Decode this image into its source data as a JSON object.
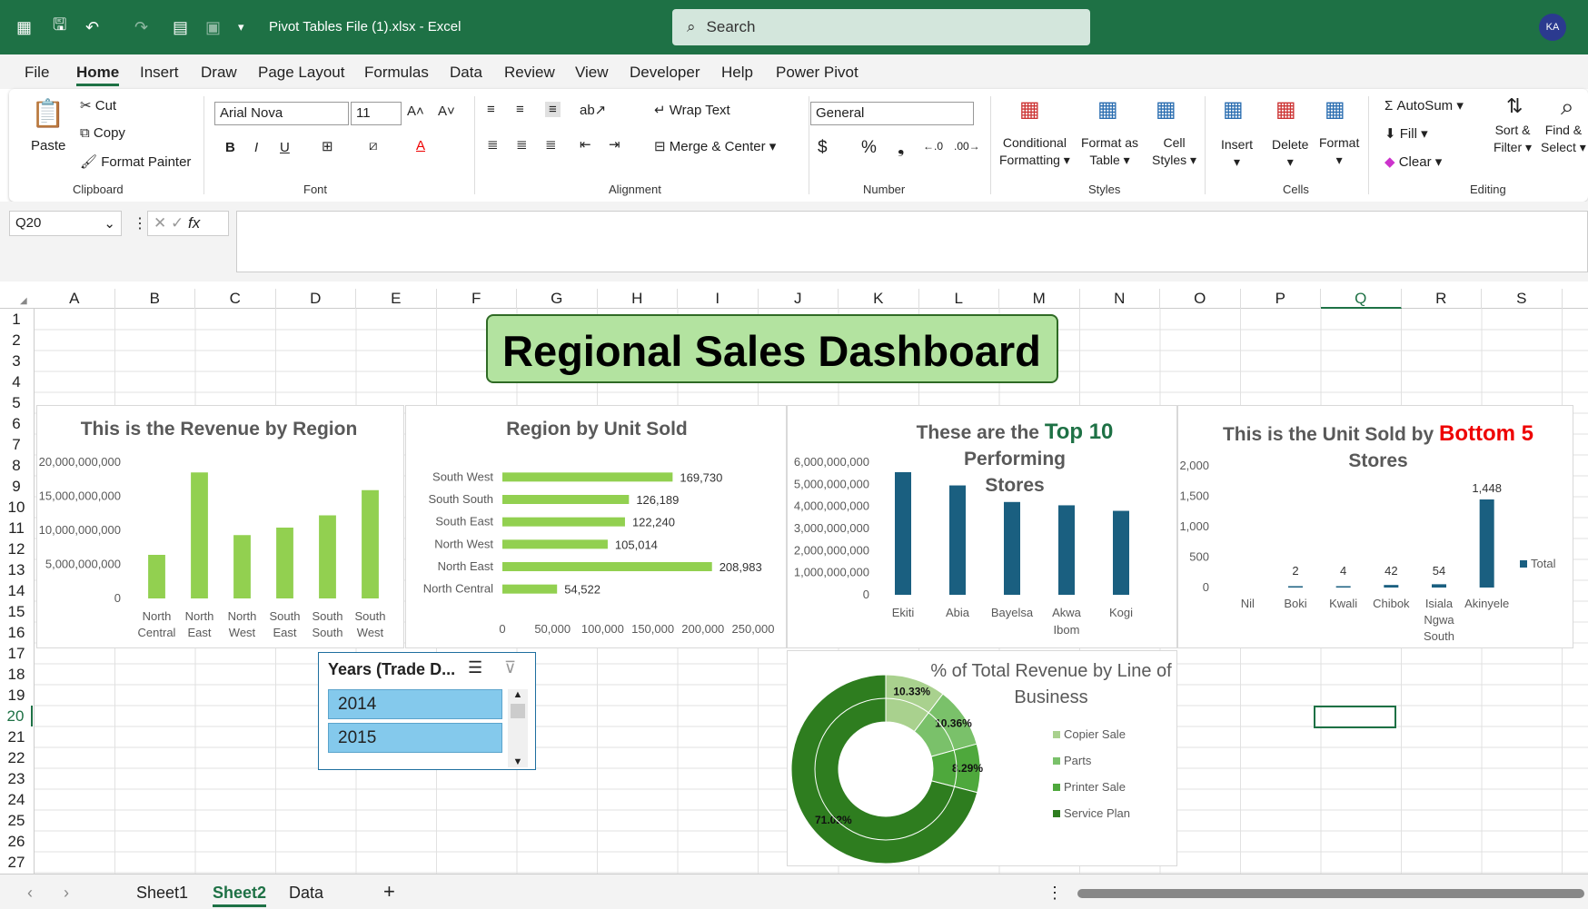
{
  "title": {
    "file": "Pivot Tables File (1).xlsx  -  Excel",
    "search_placeholder": "Search",
    "avatar": "KA"
  },
  "menu": [
    "File",
    "Home",
    "Insert",
    "Draw",
    "Page Layout",
    "Formulas",
    "Data",
    "Review",
    "View",
    "Developer",
    "Help",
    "Power Pivot"
  ],
  "ribbon": {
    "paste": "Paste",
    "cut": "Cut",
    "copy": "Copy",
    "format_painter": "Format Painter",
    "clipboard": "Clipboard",
    "font_name": "Arial Nova",
    "font_size": "11",
    "font": "Font",
    "wrap": "Wrap Text",
    "merge": "Merge & Center",
    "alignment": "Alignment",
    "numfmt": "General",
    "number": "Number",
    "cond1": "Conditional",
    "cond2": "Formatting",
    "fat1": "Format as",
    "fat2": "Table",
    "cs1": "Cell",
    "cs2": "Styles",
    "styles": "Styles",
    "insert": "Insert",
    "delete": "Delete",
    "format": "Format",
    "cells": "Cells",
    "autosum": "AutoSum",
    "fill": "Fill",
    "clear": "Clear",
    "sort1": "Sort &",
    "sort2": "Filter",
    "find1": "Find &",
    "find2": "Select",
    "editing": "Editing"
  },
  "namebox": "Q20",
  "columns": [
    "A",
    "B",
    "C",
    "D",
    "E",
    "F",
    "G",
    "H",
    "I",
    "J",
    "K",
    "L",
    "M",
    "N",
    "O",
    "P",
    "Q",
    "R",
    "S"
  ],
  "rows": [
    "1",
    "2",
    "3",
    "4",
    "5",
    "6",
    "7",
    "8",
    "9",
    "10",
    "11",
    "12",
    "13",
    "14",
    "15",
    "16",
    "17",
    "18",
    "19",
    "20",
    "21",
    "22",
    "23",
    "24",
    "25",
    "26",
    "27"
  ],
  "banner": "Regional Sales Dashboard",
  "chart_data": [
    {
      "type": "bar",
      "title": "This is the Revenue by Region",
      "categories": [
        "North Central",
        "North East",
        "North West",
        "South East",
        "South South",
        "South West"
      ],
      "values": [
        6400000000,
        18500000000,
        9300000000,
        10400000000,
        12200000000,
        15900000000
      ],
      "ylim": [
        0,
        20000000000
      ],
      "yticks": [
        "20,000,000,000",
        "15,000,000,000",
        "10,000,000,000",
        "5,000,000,000",
        "0"
      ],
      "color": "#92d050"
    },
    {
      "type": "bar",
      "orientation": "horizontal",
      "title": "Region by Unit Sold",
      "categories": [
        "South West",
        "South South",
        "South East",
        "North West",
        "North East",
        "North Central"
      ],
      "values": [
        169730,
        126189,
        122240,
        105014,
        208983,
        54522
      ],
      "labels": [
        "169,730",
        "126,189",
        "122,240",
        "105,014",
        "208,983",
        "54,522"
      ],
      "xlim": [
        0,
        250000
      ],
      "xticks": [
        "0",
        "50,000",
        "100,000",
        "150,000",
        "200,000",
        "250,000"
      ],
      "color": "#92d050"
    },
    {
      "type": "bar",
      "title_a": "These are the ",
      "title_b": "Top 10",
      "title_c": " Performing",
      "title_d": "Stores",
      "categories": [
        "Ekiti",
        "Abia",
        "Bayelsa",
        "Akwa Ibom",
        "Kogi"
      ],
      "values": [
        5550000000,
        4950000000,
        4200000000,
        4050000000,
        3800000000
      ],
      "ylim": [
        0,
        6000000000
      ],
      "yticks": [
        "6,000,000,000",
        "5,000,000,000",
        "4,000,000,000",
        "3,000,000,000",
        "2,000,000,000",
        "1,000,000,000",
        "0"
      ],
      "color": "#1a5f80"
    },
    {
      "type": "bar",
      "title_a": "This is the Unit Sold by ",
      "title_b": "Bottom 5",
      "title_c": "Stores",
      "categories": [
        "Nil",
        "Boki",
        "Kwali",
        "Chibok",
        "Isiala Ngwa South",
        "Akinyele"
      ],
      "values": [
        0,
        2,
        4,
        42,
        54,
        1448
      ],
      "labels": [
        "",
        "2",
        "4",
        "42",
        "54",
        "1,448"
      ],
      "ylim": [
        0,
        2000
      ],
      "yticks": [
        "2,000",
        "1,500",
        "1,000",
        "500",
        "0"
      ],
      "legend": "Total",
      "color": "#1a5f80"
    },
    {
      "type": "pie",
      "title": "% of Total Revenue by Line of Business",
      "categories": [
        "Copier Sale",
        "Parts",
        "Printer Sale",
        "Service Plan"
      ],
      "values": [
        10.33,
        10.36,
        8.29,
        71.02
      ],
      "labels": [
        "10.33%",
        "10.36%",
        "8.29%",
        "71.02%"
      ],
      "colors": [
        "#a9d18e",
        "#7ac16a",
        "#4ea83c",
        "#2e7d1f"
      ]
    }
  ],
  "slicer": {
    "title": "Years (Trade D...",
    "items": [
      "2014",
      "2015"
    ]
  },
  "tabs": [
    "Sheet1",
    "Sheet2",
    "Data"
  ]
}
